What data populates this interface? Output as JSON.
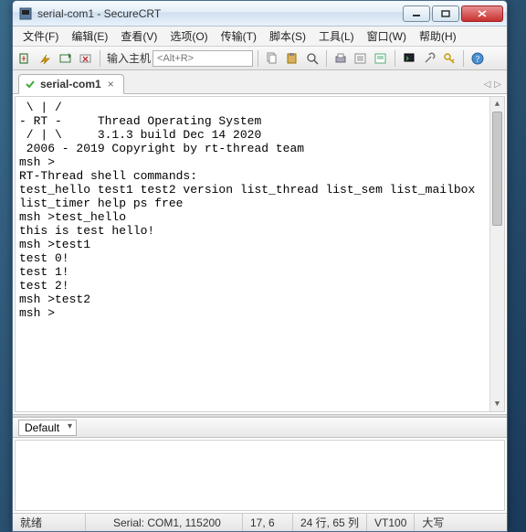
{
  "window": {
    "title": "serial-com1 - SecureCRT"
  },
  "menu": {
    "items": [
      "文件(F)",
      "编辑(E)",
      "查看(V)",
      "选项(O)",
      "传输(T)",
      "脚本(S)",
      "工具(L)",
      "窗口(W)",
      "帮助(H)"
    ]
  },
  "toolbar": {
    "host_label": "输入主机",
    "host_placeholder": "<Alt+R>"
  },
  "tab": {
    "label": "serial-com1",
    "close": "×"
  },
  "terminal_lines": [
    " \\ | /",
    "- RT -     Thread Operating System",
    " / | \\     3.1.3 build Dec 14 2020",
    " 2006 - 2019 Copyright by rt-thread team",
    "msh >",
    "RT-Thread shell commands:",
    "test_hello test1 test2 version list_thread list_sem list_mailbox",
    "list_timer help ps free",
    "msh >test_hello",
    "this is test hello!",
    "msh >test1",
    "test 0!",
    "test 1!",
    "test 2!",
    "msh >test2",
    "msh >"
  ],
  "session": {
    "selected": "Default"
  },
  "status": {
    "ready": "就绪",
    "port": "Serial: COM1, 115200",
    "cursor": "17,    6",
    "size": "24 行, 65 列",
    "emu": "VT100",
    "caps": "大写"
  },
  "icons": {
    "app": "app-icon"
  }
}
